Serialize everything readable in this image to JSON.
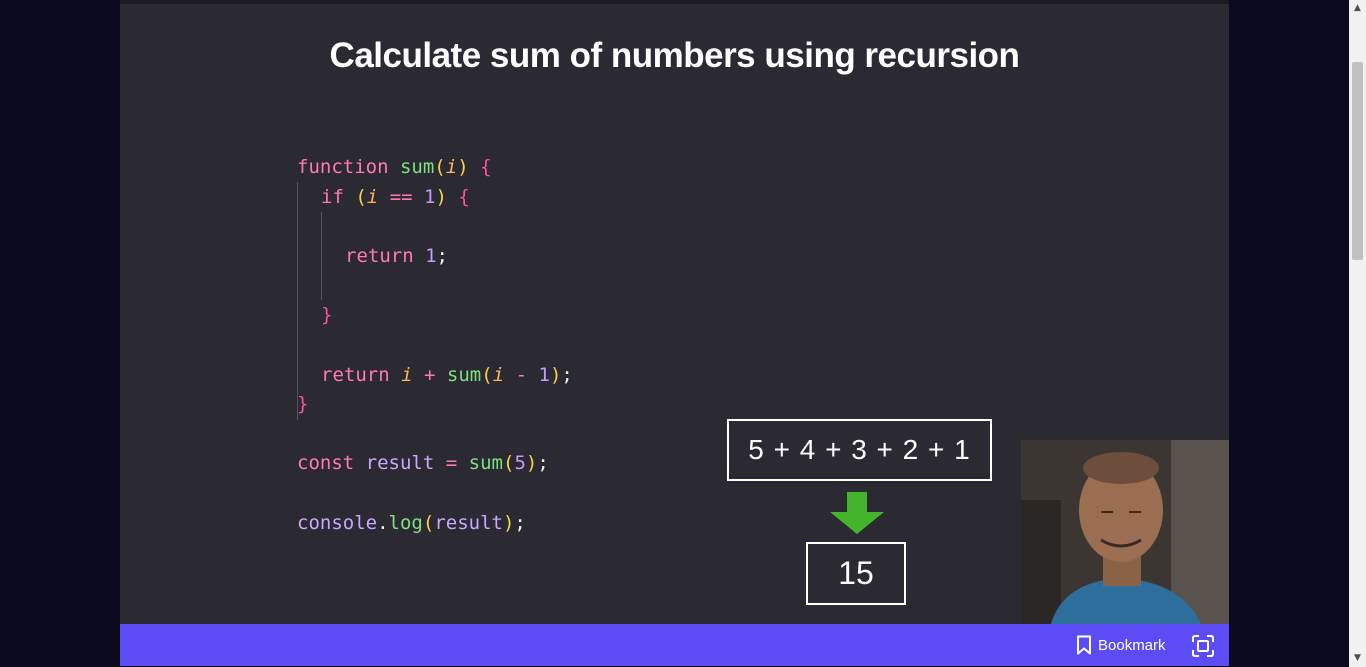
{
  "slide": {
    "title": "Calculate sum of numbers using recursion"
  },
  "code_lines": [
    "function sum(i) {",
    "if (i == 1) {",
    "return 1;",
    "}",
    "return i + sum(i - 1);",
    "}",
    "const result = sum(5);",
    "console.log(result);"
  ],
  "diagram": {
    "expression": "5 + 4 + 3 + 2 + 1",
    "result": "15",
    "arrow_color": "#44b52a"
  },
  "webcam": {
    "icon": "presenter-video-icon"
  },
  "bottom_bar": {
    "bookmark_label": "Bookmark",
    "bookmark_icon": "bookmark-icon",
    "fullscreen_icon": "fullscreen-icon",
    "bar_color": "#5b4cf5"
  },
  "scrollbar": {
    "up_arrow": "▲",
    "down_arrow": "▼"
  }
}
